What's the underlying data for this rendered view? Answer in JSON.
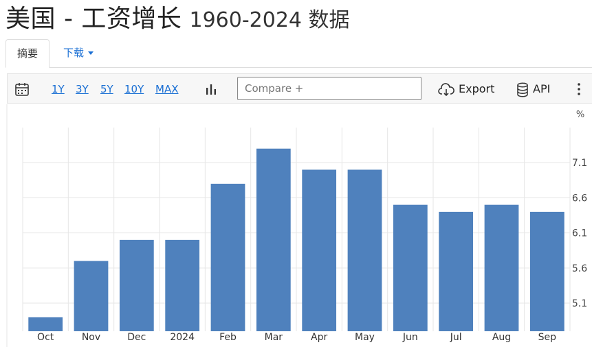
{
  "title": {
    "main": "美国 - 工资增长",
    "sub": "1960-2024 数据"
  },
  "tabs": {
    "summary": "摘要",
    "download": "下载"
  },
  "toolbar": {
    "ranges": [
      "1Y",
      "3Y",
      "5Y",
      "10Y",
      "MAX"
    ],
    "compare_placeholder": "Compare +",
    "export_label": "Export",
    "api_label": "API"
  },
  "colors": {
    "bar": "#4f81bd",
    "link": "#1a6fd4",
    "grid": "#e6e6e6"
  },
  "chart_data": {
    "type": "bar",
    "unit": "%",
    "categories": [
      "Oct",
      "Nov",
      "Dec",
      "2024",
      "Feb",
      "Mar",
      "Apr",
      "May",
      "Jun",
      "Jul",
      "Aug",
      "Sep"
    ],
    "values": [
      4.9,
      5.7,
      6.0,
      6.0,
      6.8,
      7.3,
      7.0,
      7.0,
      6.5,
      6.4,
      6.5,
      6.4
    ],
    "yticks": [
      5.1,
      5.6,
      6.1,
      6.6,
      7.1
    ],
    "ylim": [
      4.7,
      7.6
    ],
    "grid": true,
    "yaxis_position": "right"
  }
}
